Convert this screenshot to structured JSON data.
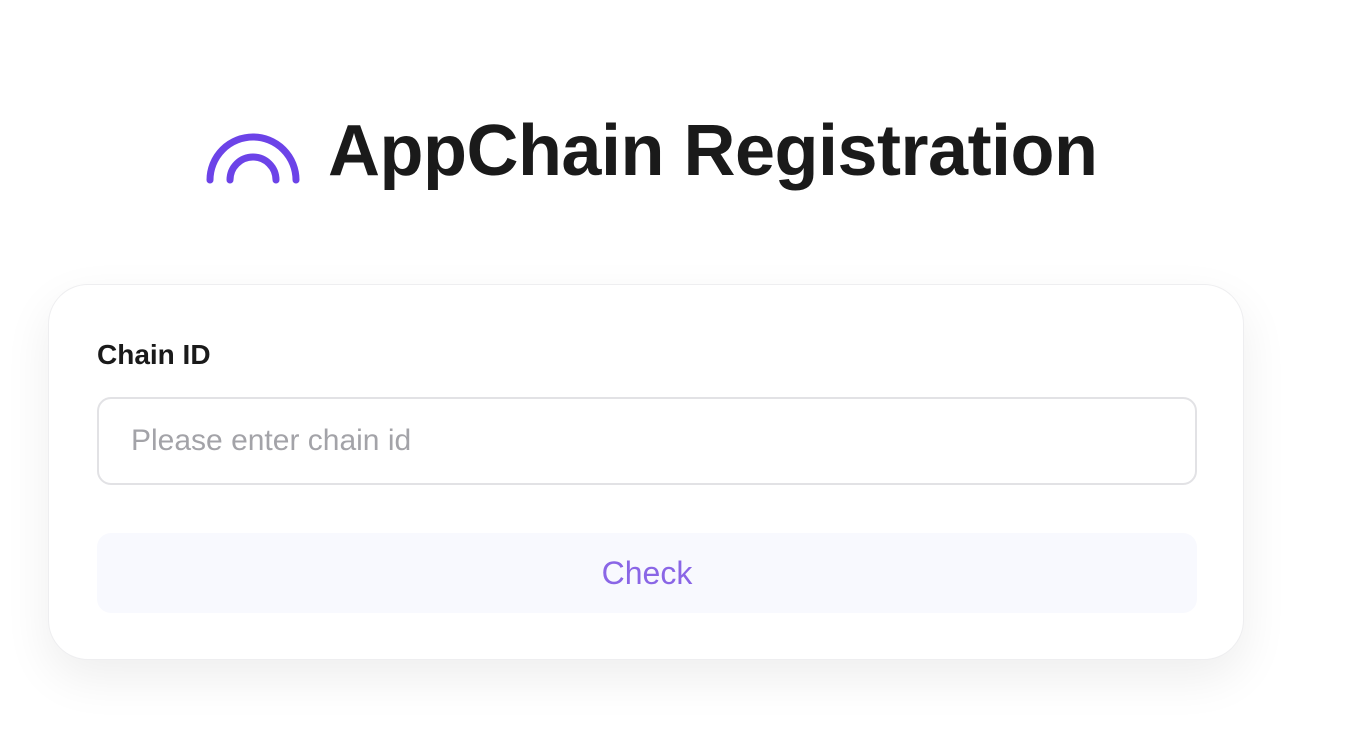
{
  "header": {
    "logo_icon": "rainbow-arc-icon",
    "title": "AppChain Registration"
  },
  "form": {
    "chain_id_label": "Chain ID",
    "chain_id_value": "",
    "chain_id_placeholder": "Please enter chain id",
    "check_label": "Check"
  },
  "colors": {
    "accent": "#6c43e8",
    "button_text": "#8a66e6",
    "button_bg": "#f8f9fe",
    "title_text": "#1a1a1a"
  }
}
